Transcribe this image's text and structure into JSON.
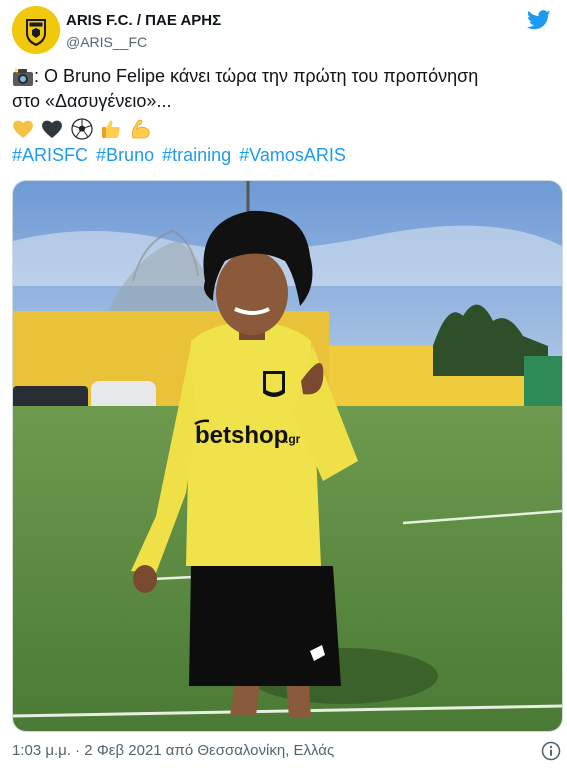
{
  "tweet": {
    "display_name": "ARIS F.C. / ΠΑΕ ΑΡΗΣ",
    "handle": "@ARIS__FC",
    "text_line_1": ": Ο Bruno Felipe κάνει τώρα την πρώτη του προπόνηση",
    "text_line_2": "στο «Δασυγένειο»...",
    "camera_emoji": "camera-flash",
    "emojis": [
      "yellow-heart",
      "black-heart",
      "soccer-ball",
      "thumbs-up",
      "flexed-biceps"
    ],
    "hashtags": [
      "#ARISFC",
      "#Bruno",
      "#training",
      "#VamosARIS"
    ],
    "timestamp": "1:03 μ.μ. · 2 Φεβ 2021 από Θεσσαλονίκη, Ελλάς",
    "jersey_sponsor": "betshop",
    "jersey_sponsor_suffix": ".gr"
  },
  "colors": {
    "link": "#1d9bf0",
    "twitter_blue": "#1d9bf0",
    "club_yellow": "#f2c80f",
    "text_secondary": "#536471"
  }
}
